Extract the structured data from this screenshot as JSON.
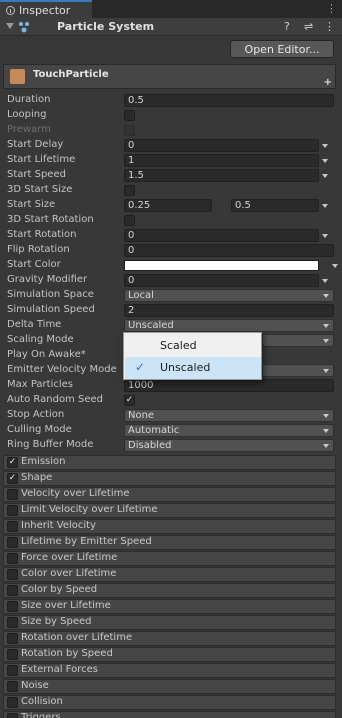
{
  "tab": {
    "title": "Inspector",
    "icon": "info-icon",
    "more_icon": "kebab-menu-icon"
  },
  "component": {
    "title": "Particle System",
    "icon": "particle-system-icon",
    "header_icons": [
      "help-icon",
      "preset-sliders-icon",
      "context-menu-icon"
    ]
  },
  "open_editor_label": "Open Editor...",
  "system": {
    "name": "TouchParticle",
    "icon": "particle-asset-icon",
    "add_label": "+"
  },
  "properties": {
    "duration": {
      "label": "Duration",
      "value": "0.5"
    },
    "looping": {
      "label": "Looping",
      "checked": false
    },
    "prewarm": {
      "label": "Prewarm",
      "checked": false,
      "disabled": true
    },
    "start_delay": {
      "label": "Start Delay",
      "value": "0"
    },
    "start_lifetime": {
      "label": "Start Lifetime",
      "value": "1"
    },
    "start_speed": {
      "label": "Start Speed",
      "value": "1.5"
    },
    "start_size_3d": {
      "label": "3D Start Size",
      "checked": false
    },
    "start_size": {
      "label": "Start Size",
      "min": "0.25",
      "max": "0.5"
    },
    "start_rotation_3d": {
      "label": "3D Start Rotation",
      "checked": false
    },
    "start_rotation": {
      "label": "Start Rotation",
      "value": "0"
    },
    "flip_rotation": {
      "label": "Flip Rotation",
      "value": "0"
    },
    "start_color": {
      "label": "Start Color",
      "color": "#ffffff"
    },
    "gravity_modifier": {
      "label": "Gravity Modifier",
      "value": "0"
    },
    "simulation_space": {
      "label": "Simulation Space",
      "value": "Local"
    },
    "simulation_speed": {
      "label": "Simulation Speed",
      "value": "2"
    },
    "delta_time": {
      "label": "Delta Time",
      "value": "Unscaled"
    },
    "scaling_mode": {
      "label": "Scaling Mode"
    },
    "play_on_awake": {
      "label": "Play On Awake*"
    },
    "emitter_velocity_mode": {
      "label": "Emitter Velocity Mode"
    },
    "max_particles": {
      "label": "Max Particles",
      "value": "1000"
    },
    "auto_random_seed": {
      "label": "Auto Random Seed",
      "checked": true
    },
    "stop_action": {
      "label": "Stop Action",
      "value": "None"
    },
    "culling_mode": {
      "label": "Culling Mode",
      "value": "Automatic"
    },
    "ring_buffer_mode": {
      "label": "Ring Buffer Mode",
      "value": "Disabled"
    }
  },
  "delta_time_popup": {
    "options": [
      "Scaled",
      "Unscaled"
    ],
    "selected": "Unscaled",
    "check_icon": "checkmark-icon"
  },
  "modules": [
    {
      "label": "Emission",
      "enabled": true
    },
    {
      "label": "Shape",
      "enabled": true
    },
    {
      "label": "Velocity over Lifetime",
      "enabled": false
    },
    {
      "label": "Limit Velocity over Lifetime",
      "enabled": false
    },
    {
      "label": "Inherit Velocity",
      "enabled": false
    },
    {
      "label": "Lifetime by Emitter Speed",
      "enabled": false
    },
    {
      "label": "Force over Lifetime",
      "enabled": false
    },
    {
      "label": "Color over Lifetime",
      "enabled": false
    },
    {
      "label": "Color by Speed",
      "enabled": false
    },
    {
      "label": "Size over Lifetime",
      "enabled": false
    },
    {
      "label": "Size by Speed",
      "enabled": false
    },
    {
      "label": "Rotation over Lifetime",
      "enabled": false
    },
    {
      "label": "Rotation by Speed",
      "enabled": false
    },
    {
      "label": "External Forces",
      "enabled": false
    },
    {
      "label": "Noise",
      "enabled": false
    },
    {
      "label": "Collision",
      "enabled": false
    },
    {
      "label": "Triggers",
      "enabled": false
    }
  ],
  "checkmark_glyph": "✓"
}
